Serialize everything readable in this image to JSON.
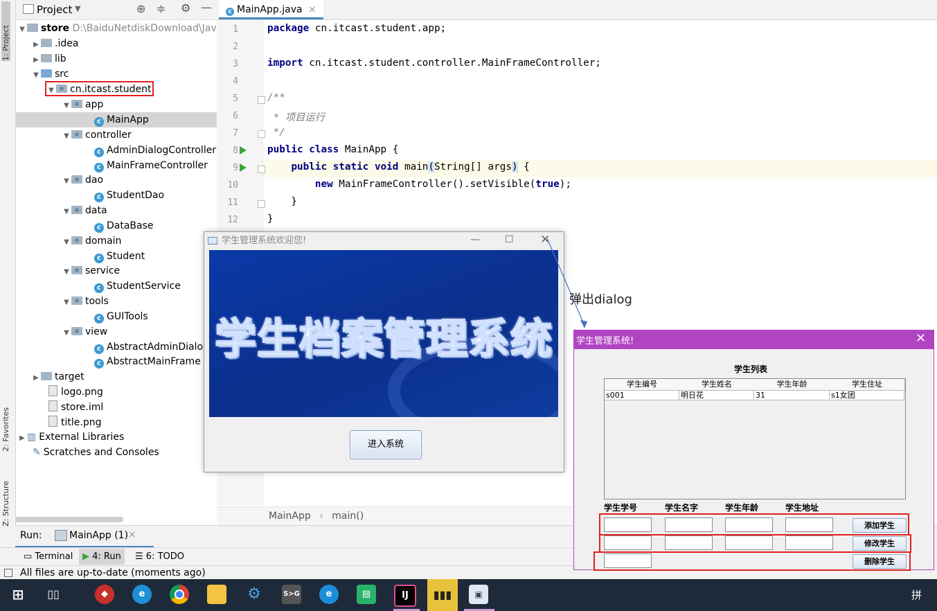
{
  "ide": {
    "left_tabs": [
      "1: Project",
      "2: Favorites",
      "Z: Structure"
    ],
    "project_header": {
      "title": "Project"
    },
    "tree": [
      {
        "label": "store",
        "path": "D:\\BaiduNetdiskDownload\\Java-("
      },
      {
        "label": ".idea"
      },
      {
        "label": "lib"
      },
      {
        "label": "src"
      },
      {
        "label": "cn.itcast.student"
      },
      {
        "label": "app"
      },
      {
        "label": "MainApp"
      },
      {
        "label": "controller"
      },
      {
        "label": "AdminDialogController"
      },
      {
        "label": "MainFrameController"
      },
      {
        "label": "dao"
      },
      {
        "label": "StudentDao"
      },
      {
        "label": "data"
      },
      {
        "label": "DataBase"
      },
      {
        "label": "domain"
      },
      {
        "label": "Student"
      },
      {
        "label": "service"
      },
      {
        "label": "StudentService"
      },
      {
        "label": "tools"
      },
      {
        "label": "GUITools"
      },
      {
        "label": "view"
      },
      {
        "label": "AbstractAdminDialog"
      },
      {
        "label": "AbstractMainFrame"
      },
      {
        "label": "target"
      },
      {
        "label": "logo.png"
      },
      {
        "label": "store.iml"
      },
      {
        "label": "title.png"
      },
      {
        "label": "External Libraries"
      },
      {
        "label": "Scratches and Consoles"
      }
    ],
    "editor_tab": "MainApp.java",
    "line_numbers": [
      "1",
      "2",
      "3",
      "4",
      "5",
      "6",
      "7",
      "8",
      "9",
      "10",
      "11",
      "12"
    ],
    "code": {
      "l1_kw": "package",
      "l1_rest": " cn.itcast.student.app;",
      "l3_kw": "import",
      "l3_rest": " cn.itcast.student.controller.MainFrameController;",
      "l5": "/**",
      "l6": " * 项目运行",
      "l7": " */",
      "l8_kw": "public class",
      "l8_rest": " MainApp {",
      "l9_indent": "    ",
      "l9_kw": "public static void",
      "l9_a": " main",
      "l9_p1": "(",
      "l9_b": "String[] args",
      "l9_p2": ")",
      "l9_c": " {",
      "l10_indent": "        ",
      "l10_kw": "new",
      "l10_a": " MainFrameController().setVisible(",
      "l10_kw2": "true",
      "l10_b": ");",
      "l11": "    }",
      "l12": "}"
    },
    "breadcrumb": [
      "MainApp",
      "main()"
    ],
    "run_bar": {
      "label": "Run:",
      "config": "MainApp (1)"
    },
    "bottom_tabs": [
      "Terminal",
      "4: Run",
      "6: TODO"
    ],
    "status": "All files are up-to-date (moments ago)"
  },
  "welcome_window": {
    "title": "学生管理系统欢迎您!",
    "banner_text": "学生档案管理系统",
    "enter_button": "进入系统"
  },
  "annotation": "弹出dialog",
  "dialog": {
    "title": "学生管理系统!",
    "table_title": "学生列表",
    "columns": [
      "学生编号",
      "学生姓名",
      "学生年龄",
      "学生住址"
    ],
    "rows": [
      [
        "s001",
        "明日花",
        "31",
        "s1女团"
      ]
    ],
    "field_labels": [
      "学生学号",
      "学生名字",
      "学生年龄",
      "学生地址"
    ],
    "buttons": {
      "add": "添加学生",
      "edit": "修改学生",
      "delete": "删除学生"
    }
  },
  "taskbar": {
    "icons": [
      "windows-start-icon",
      "task-view-icon",
      "app-red-icon",
      "edge-icon",
      "chrome-icon",
      "file-explorer-icon",
      "settings-icon",
      "sg-app-icon",
      "ie-icon",
      "recycle-icon",
      "intellij-icon",
      "powerbi-icon",
      "java-window-icon"
    ],
    "ime": "拼"
  },
  "colors": {
    "dialog_title": "#b044c3",
    "banner": "#0b2f8c",
    "highlight_box": "#e02020"
  }
}
